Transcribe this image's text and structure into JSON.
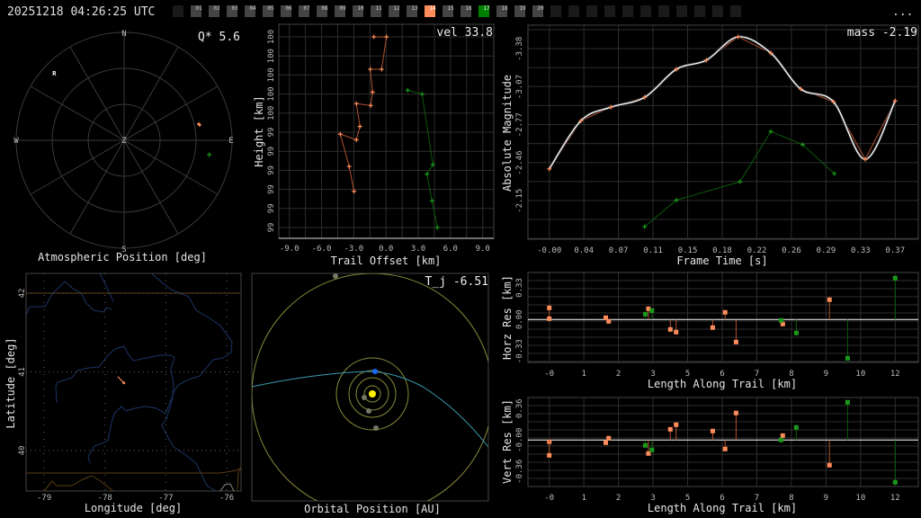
{
  "header": {
    "timestamp": "20251218 04:26:25 UTC",
    "menu_label": "...",
    "slot_labels": [
      "",
      "01",
      "02",
      "03",
      "04",
      "05",
      "06",
      "07",
      "08",
      "09",
      "10",
      "11",
      "12",
      "13",
      "14",
      "15",
      "16",
      "17",
      "18",
      "19",
      "20",
      "",
      "",
      "",
      "",
      "",
      "",
      "",
      "",
      "",
      "",
      ""
    ],
    "slot_highlights": {
      "14": "#ff8c5a",
      "17": "#008000"
    }
  },
  "colors": {
    "station_a": "#ff8c5a",
    "station_a_line": "#b0502e",
    "station_b": "#1a9a1a",
    "station_b_line": "#0b5a0b",
    "fit": "#ffffff"
  },
  "polar": {
    "title": "Atmospheric Position [deg]",
    "stat": "Q*  5.6",
    "labels": {
      "n": "N",
      "s": "S",
      "e": "E",
      "w": "W",
      "z": "Z",
      "radiant": "R"
    },
    "radiant": {
      "az": 314,
      "alt": 9
    },
    "points": [
      {
        "station": "a",
        "az": 78.4,
        "alt": 26.5
      },
      {
        "station": "b",
        "az": 99.6,
        "alt": 18
      }
    ]
  },
  "map": {
    "xlabel": "Longitude [deg]",
    "ylabel": "Latitude [deg]",
    "lon_ticks": [
      "-79",
      "-78",
      "-77",
      "-76"
    ],
    "lat_ticks": [
      "42",
      "41",
      "40"
    ],
    "trail": [
      [
        -77.79,
        40.94
      ],
      [
        -77.69,
        40.86
      ]
    ]
  },
  "orbit": {
    "title": "Orbital Position [AU]",
    "stat": "T_j -6.51"
  },
  "chart_data": [
    {
      "type": "line",
      "title": "",
      "stat": "vel 33.8",
      "xlabel": "Trail Offset [km]",
      "ylabel": "Height [km]",
      "xlim": [
        -9,
        9
      ],
      "x_ticks": [
        "-9.0",
        "-6.0",
        "-3.0",
        "0.0",
        "3.0",
        "6.0",
        "9.0"
      ],
      "ylim": [
        100.5,
        99.5
      ],
      "y_ticks": [
        "100",
        "100",
        "100",
        "100",
        "100",
        "99",
        "99",
        "99",
        "99",
        "99",
        "99"
      ],
      "series": [
        {
          "name": "station_a",
          "x": [
            -1.13,
            0.04,
            -0.41,
            -1.47,
            -1.25,
            -1.42,
            -2.76,
            -2.43,
            -2.76,
            -4.26,
            -3.43,
            -2.98
          ],
          "y": [
            100.5,
            100.5,
            100.33,
            100.33,
            100.21,
            100.14,
            100.15,
            100.03,
            99.96,
            99.99,
            99.82,
            99.69
          ]
        },
        {
          "name": "station_b",
          "x": [
            2.02,
            3.36,
            4.36,
            3.81,
            4.28,
            4.78
          ],
          "y": [
            100.22,
            100.2,
            99.83,
            99.78,
            99.64,
            99.5
          ]
        }
      ]
    },
    {
      "type": "line",
      "stat": "mass -2.19",
      "xlabel": "Frame Time [s]",
      "ylabel": "Absolute Magnitude",
      "xlim": [
        0,
        0.37
      ],
      "x_ticks": [
        "-0.00",
        "0.04",
        "0.07",
        "0.11",
        "0.15",
        "0.18",
        "0.22",
        "0.26",
        "0.29",
        "0.33",
        "0.37"
      ],
      "ylim": [
        -3.38,
        -2.15
      ],
      "y_ticks": [
        "-3.38",
        "-3.07",
        "-2.77",
        "-2.46",
        "-2.15"
      ],
      "series": [
        {
          "name": "station_a",
          "x": [
            0,
            0.034,
            0.066,
            0.102,
            0.136,
            0.168,
            0.202,
            0.237,
            0.269,
            0.304,
            0.338,
            0.37
          ],
          "y": [
            -2.408,
            -2.799,
            -2.908,
            -2.988,
            -3.215,
            -3.288,
            -3.477,
            -3.346,
            -3.055,
            -2.951,
            -2.486,
            -2.959
          ]
        },
        {
          "name": "station_b",
          "x": [
            0.102,
            0.136,
            0.204,
            0.237,
            0.271,
            0.305
          ],
          "y": [
            -1.941,
            -2.156,
            -2.304,
            -2.711,
            -2.605,
            -2.37
          ]
        }
      ]
    },
    {
      "type": "scatter",
      "xlabel": "Length Along Trail [km]",
      "ylabel": "Horz Res [km]",
      "xlim": [
        0,
        12
      ],
      "x_ticks": [
        "-0",
        "1",
        "2",
        "3",
        "5",
        "6",
        "7",
        "8",
        "9",
        "10",
        "12"
      ],
      "y_ticks": [
        "0.33",
        "0.00",
        "-0.33"
      ],
      "y_tick_values": [
        0.33,
        0,
        -0.33
      ],
      "series": [
        {
          "name": "station_a",
          "x": [
            0,
            0,
            1.96,
            2.06,
            3.44,
            4.2,
            4.4,
            5.67,
            6.1,
            6.48,
            8.1,
            9.72
          ],
          "y": [
            0.121,
            0.009,
            0.019,
            -0.019,
            0.112,
            -0.103,
            -0.131,
            -0.084,
            0.075,
            -0.234,
            -0.047,
            0.206
          ]
        },
        {
          "name": "station_b",
          "x": [
            3.33,
            3.56,
            8.04,
            8.57,
            10.35,
            12.0
          ],
          "y": [
            0.056,
            0.093,
            -0.009,
            -0.14,
            -0.402,
            0.43
          ]
        }
      ]
    },
    {
      "type": "scatter",
      "xlabel": "Length Along Trail [km]",
      "ylabel": "Vert Res [km]",
      "xlim": [
        0,
        12
      ],
      "x_ticks": [
        "-0",
        "1",
        "2",
        "3",
        "5",
        "6",
        "7",
        "8",
        "9",
        "10",
        "12"
      ],
      "y_ticks": [
        "0.36",
        "-0.00",
        "-0.36"
      ],
      "y_tick_values": [
        0.36,
        0,
        -0.36
      ],
      "series": [
        {
          "name": "station_a",
          "x": [
            0,
            0,
            1.96,
            2.06,
            3.44,
            4.2,
            4.4,
            5.67,
            6.1,
            6.48,
            8.1,
            9.72
          ],
          "y": [
            -0.021,
            -0.175,
            -0.031,
            0.021,
            -0.154,
            0.123,
            0.175,
            0.103,
            -0.103,
            0.309,
            0.051,
            -0.288
          ]
        },
        {
          "name": "station_b",
          "x": [
            3.33,
            3.56,
            8.04,
            8.57,
            10.35,
            12.0
          ],
          "y": [
            -0.062,
            -0.113,
            0.0,
            0.144,
            0.432,
            -0.483
          ]
        }
      ]
    }
  ]
}
